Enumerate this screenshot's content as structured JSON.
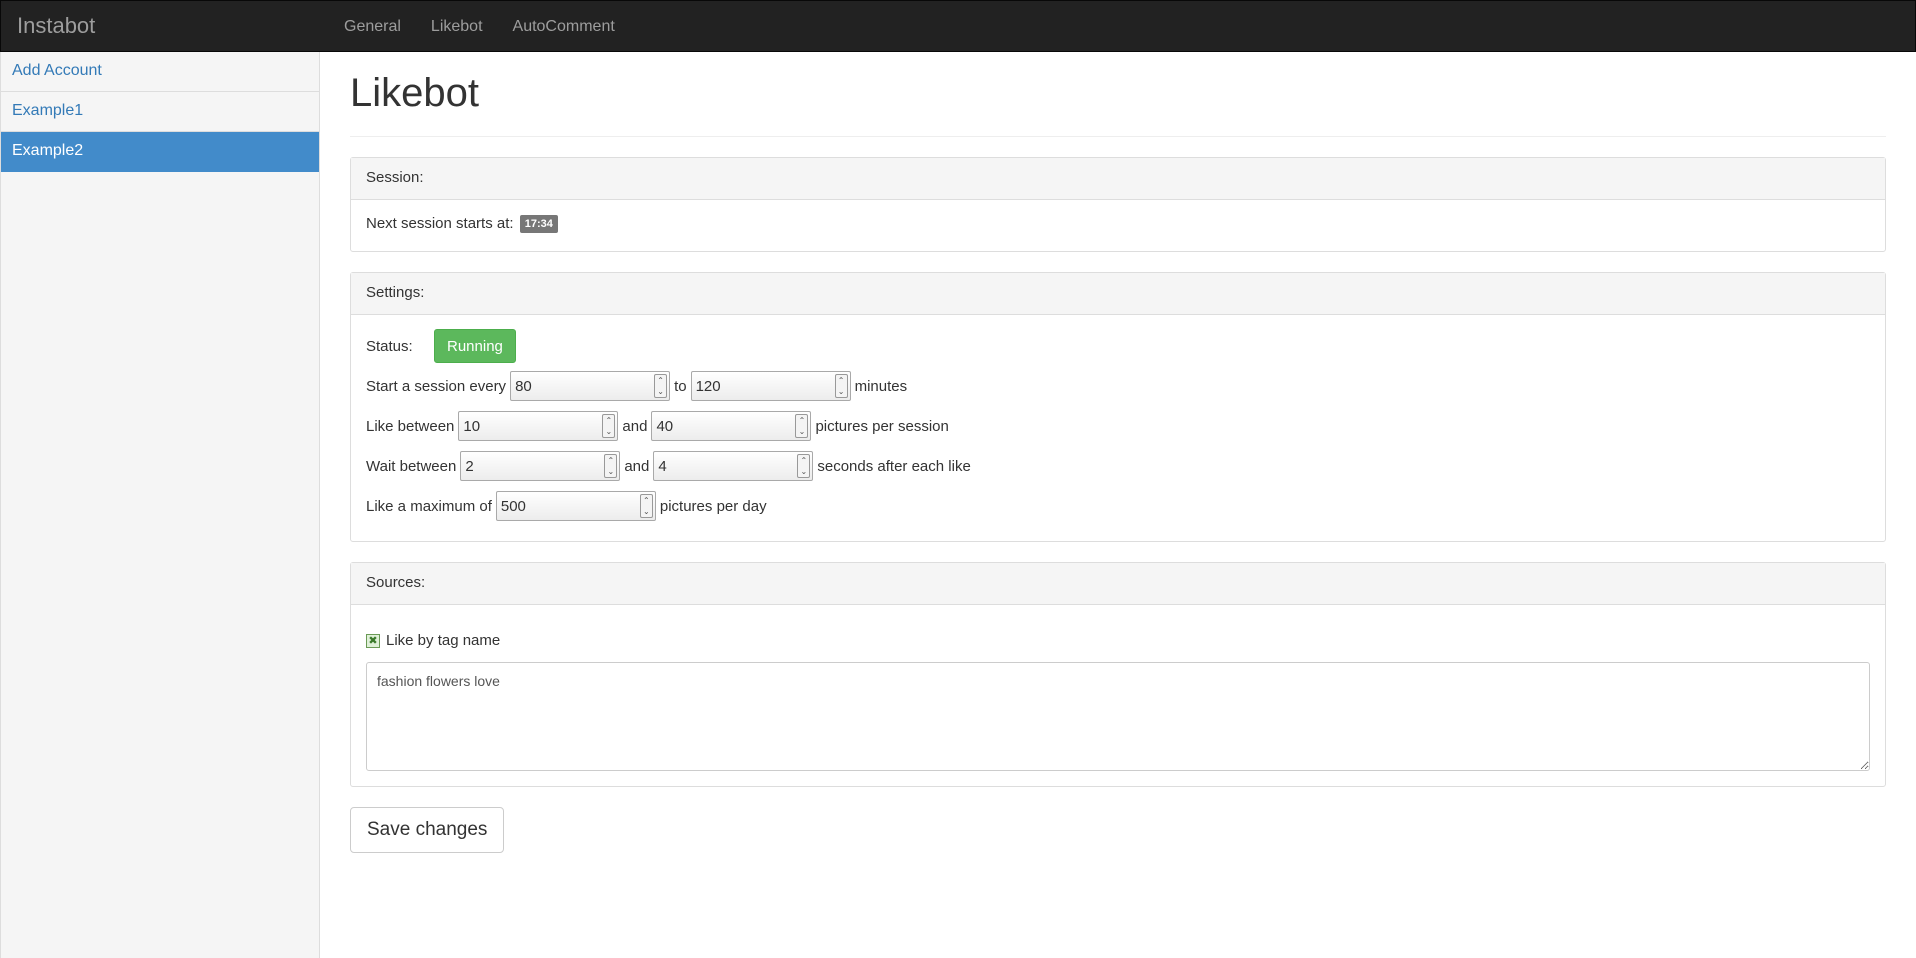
{
  "navbar": {
    "brand": "Instabot",
    "links": [
      "General",
      "Likebot",
      "AutoComment"
    ]
  },
  "sidebar": {
    "items": [
      {
        "label": "Add Account"
      },
      {
        "label": "Example1"
      },
      {
        "label": "Example2",
        "active": true
      }
    ]
  },
  "page": {
    "title": "Likebot"
  },
  "session": {
    "heading": "Session:",
    "next_label": "Next session starts at:",
    "next_time": "17:34"
  },
  "settings": {
    "heading": "Settings:",
    "status_label": "Status:",
    "status_button": "Running",
    "session_every": {
      "prefix": "Start a session every",
      "min": "80",
      "mid": "to",
      "max": "120",
      "suffix": "minutes"
    },
    "like_between": {
      "prefix": "Like between",
      "min": "10",
      "mid": "and",
      "max": "40",
      "suffix": "pictures per session"
    },
    "wait_between": {
      "prefix": "Wait between",
      "min": "2",
      "mid": "and",
      "max": "4",
      "suffix": "seconds after each like"
    },
    "max_per_day": {
      "prefix": "Like a maximum of",
      "value": "500",
      "suffix": "pictures per day"
    }
  },
  "sources": {
    "heading": "Sources:",
    "tag_checkbox_label": "Like by tag name",
    "tag_checkbox_checked": true,
    "tags": "fashion flowers love"
  },
  "save_button": "Save changes",
  "colors": {
    "accent": "#428bca",
    "success": "#5cb85c",
    "navbar": "#222222"
  }
}
